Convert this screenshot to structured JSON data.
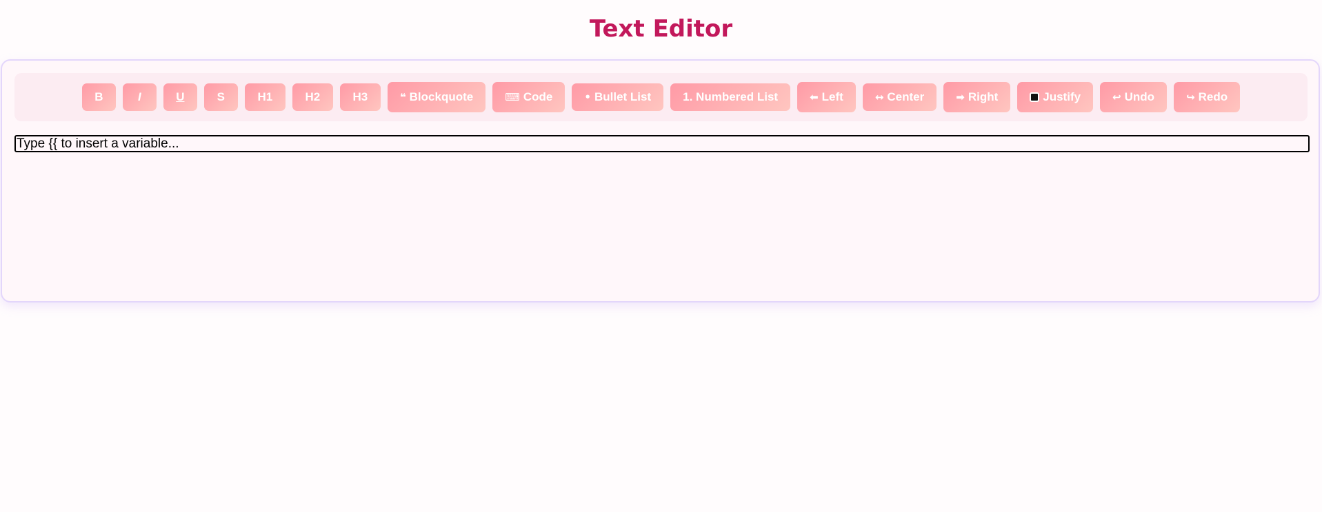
{
  "page": {
    "title": "Text Editor"
  },
  "toolbar": {
    "bold": "B",
    "italic": "I",
    "underline": "U",
    "strike": "S",
    "h1": "H1",
    "h2": "H2",
    "h3": "H3",
    "blockquote": {
      "icon": "❝",
      "label": "Blockquote"
    },
    "code": {
      "icon": "⌨",
      "label": "Code"
    },
    "bullet_list": {
      "icon": "•",
      "label": "Bullet List"
    },
    "numbered_list": {
      "label": "1. Numbered List"
    },
    "align_left": {
      "icon": "⬅",
      "label": "Left"
    },
    "align_center": {
      "icon": "↔",
      "label": "Center"
    },
    "align_right": {
      "icon": "➡",
      "label": "Right"
    },
    "justify": {
      "label": "Justify"
    },
    "undo": {
      "icon": "↩",
      "label": "Undo"
    },
    "redo": {
      "icon": "↪",
      "label": "Redo"
    }
  },
  "editor": {
    "placeholder": "Type {{ to insert a variable..."
  },
  "colors": {
    "title": "#c2185b",
    "button_gradient_start": "#ff9aa6",
    "button_gradient_end": "#ffc6c0",
    "card_border": "#e3d6fb",
    "toolbar_bg": "#fcecf2"
  }
}
